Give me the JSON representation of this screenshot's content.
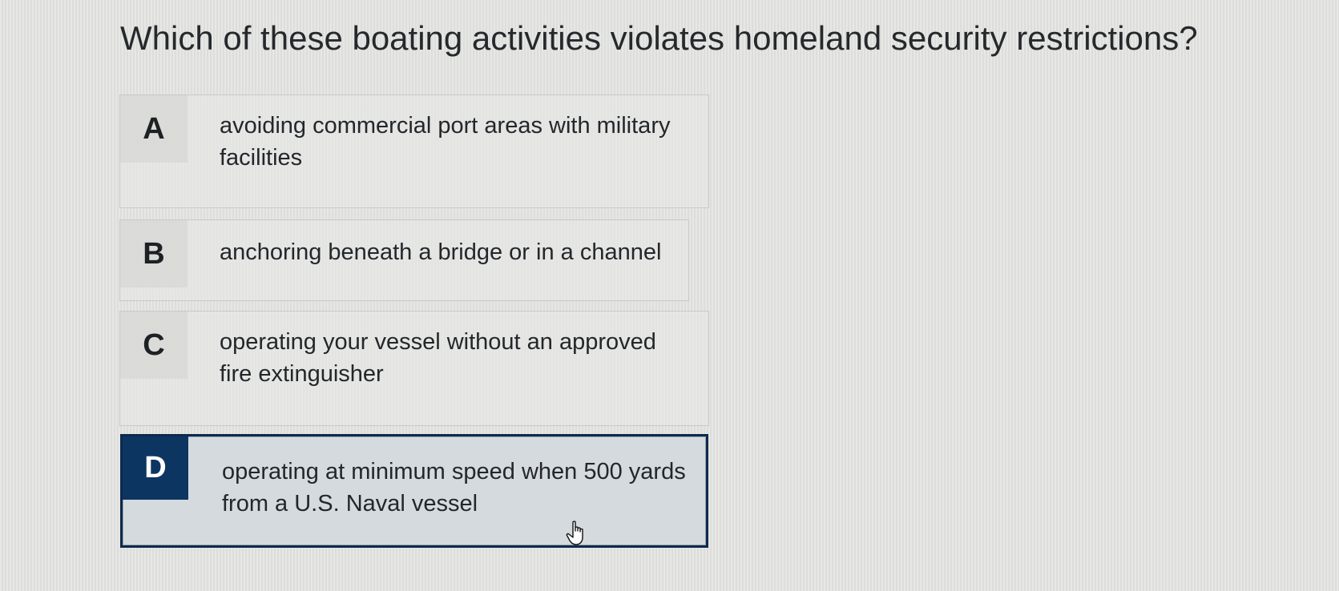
{
  "question": {
    "text": "Which of these boating activities violates homeland security restrictions?"
  },
  "options": [
    {
      "letter": "A",
      "text": "avoiding commercial port areas with military facilities",
      "selected": false
    },
    {
      "letter": "B",
      "text": "anchoring beneath a bridge or in a channel",
      "selected": false
    },
    {
      "letter": "C",
      "text": "operating your vessel without an approved fire extinguisher",
      "selected": false
    },
    {
      "letter": "D",
      "text": "operating at minimum speed when 500 yards from a U.S. Naval vessel",
      "selected": true
    }
  ],
  "colors": {
    "selected_accent": "#0d3562",
    "background": "#e4e4e2"
  },
  "icons": {
    "cursor": "hand-pointer-icon"
  }
}
